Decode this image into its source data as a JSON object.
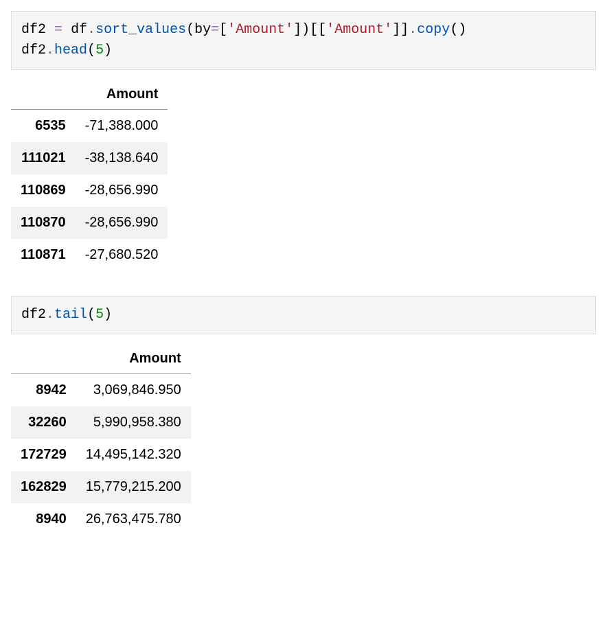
{
  "cell1": {
    "code": {
      "t1": "df2",
      "t2": " ",
      "t3": "=",
      "t4": " ",
      "t5": "df",
      "t6": ".",
      "t7": "sort_values",
      "t8": "(",
      "t9": "by",
      "t10": "=",
      "t11": "[",
      "t12": "'Amount'",
      "t13": "]",
      "t14": ")",
      "t15": "[[",
      "t16": "'Amount'",
      "t17": "]]",
      "t18": ".",
      "t19": "copy",
      "t20": "(",
      "t21": ")",
      "t22": "\n",
      "t23": "df2",
      "t24": ".",
      "t25": "head",
      "t26": "(",
      "t27": "5",
      "t28": ")"
    },
    "output": {
      "column_header": "Amount",
      "rows": [
        {
          "index": "6535",
          "amount": "-71,388.000"
        },
        {
          "index": "111021",
          "amount": "-38,138.640"
        },
        {
          "index": "110869",
          "amount": "-28,656.990"
        },
        {
          "index": "110870",
          "amount": "-28,656.990"
        },
        {
          "index": "110871",
          "amount": "-27,680.520"
        }
      ]
    }
  },
  "cell2": {
    "code": {
      "t1": "df2",
      "t2": ".",
      "t3": "tail",
      "t4": "(",
      "t5": "5",
      "t6": ")"
    },
    "output": {
      "column_header": "Amount",
      "rows": [
        {
          "index": "8942",
          "amount": "3,069,846.950"
        },
        {
          "index": "32260",
          "amount": "5,990,958.380"
        },
        {
          "index": "172729",
          "amount": "14,495,142.320"
        },
        {
          "index": "162829",
          "amount": "15,779,215.200"
        },
        {
          "index": "8940",
          "amount": "26,763,475.780"
        }
      ]
    }
  }
}
